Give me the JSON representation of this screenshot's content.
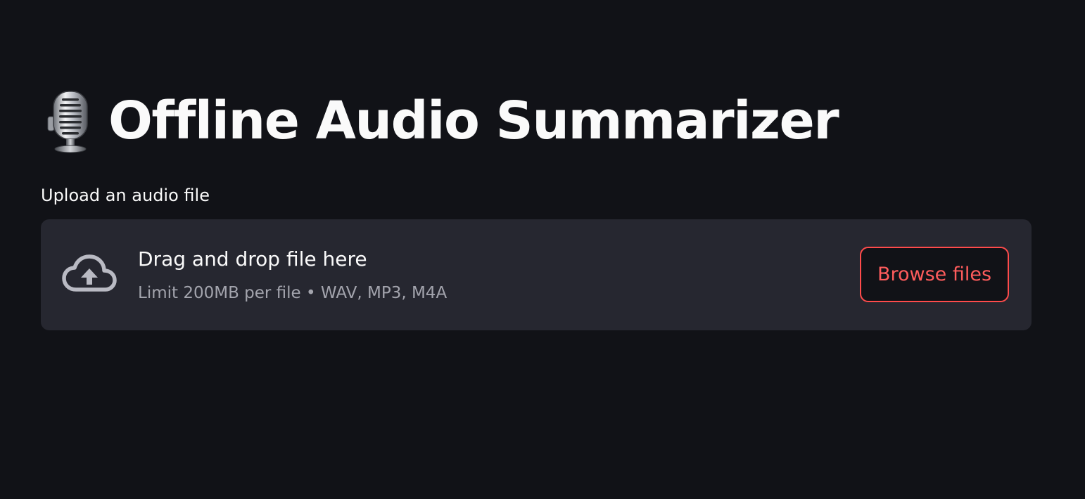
{
  "header": {
    "title": "Offline Audio Summarizer",
    "title_icon": "studio-microphone-icon"
  },
  "uploader": {
    "label": "Upload an audio file",
    "drop_title": "Drag and drop file here",
    "limits": "Limit 200MB per file • WAV, MP3, M4A",
    "upload_icon": "cloud-upload-icon",
    "browse_label": "Browse files"
  },
  "colors": {
    "background": "#111217",
    "dropzone": "#262730",
    "accent": "#ff4b4b",
    "text": "#fafafa",
    "muted_text": "#a3a4ad"
  }
}
